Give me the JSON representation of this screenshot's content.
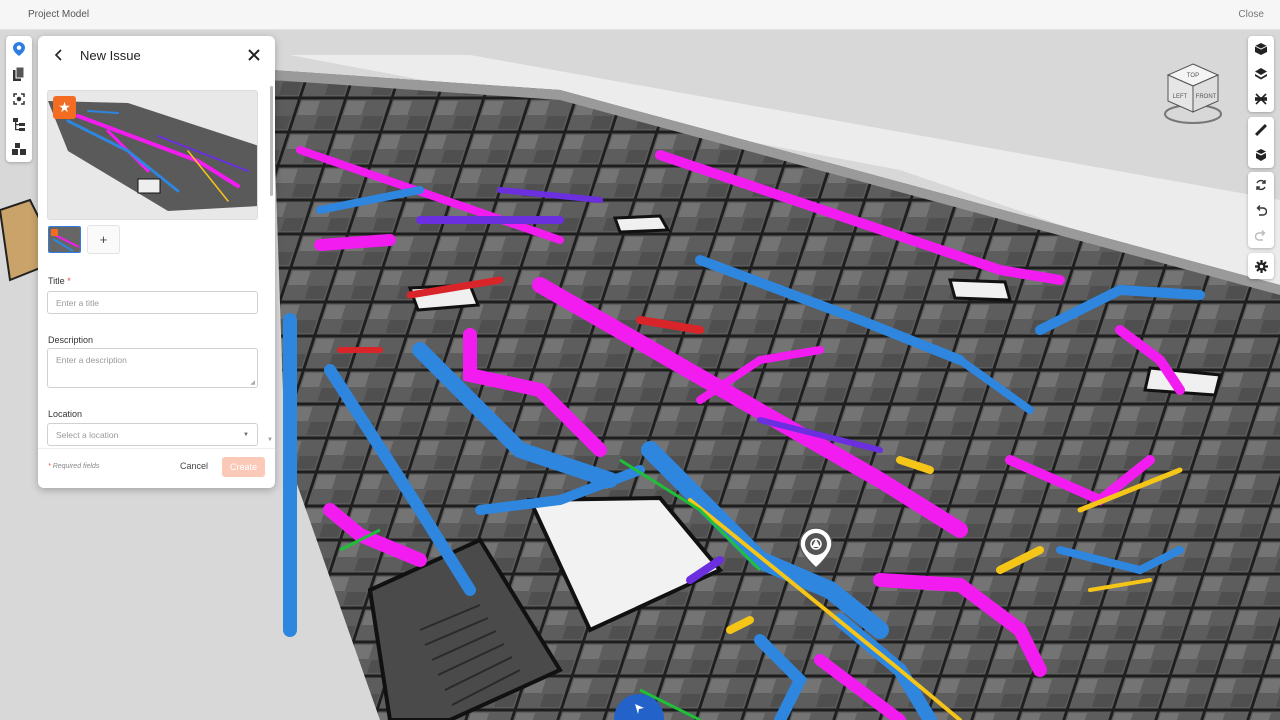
{
  "app": {
    "title": "Project Model",
    "close_label": "Close"
  },
  "panel": {
    "heading": "New Issue",
    "add_photo_label": "+",
    "title_field": {
      "label": "Title",
      "required_mark": "*",
      "placeholder": "Enter a title"
    },
    "description_field": {
      "label": "Description",
      "placeholder": "Enter a description"
    },
    "location_field": {
      "label": "Location",
      "placeholder": "Select a location"
    },
    "footer": {
      "required_mark": "*",
      "required_note": "Required fields",
      "cancel_label": "Cancel",
      "create_label": "Create"
    }
  },
  "left_toolbar": [
    "location-pin-icon",
    "documents-icon",
    "focus-frame-icon",
    "model-tree-icon",
    "objects-icon"
  ],
  "right_toolbar": {
    "group1": [
      "cube-icon",
      "layers-icon",
      "section-cut-icon"
    ],
    "group2": [
      "measure-ruler-icon",
      "explode-icon"
    ],
    "group3": [
      "refresh-icon",
      "undo-icon",
      "redo-icon"
    ],
    "group4": [
      "settings-gear-icon"
    ]
  },
  "viewcube": {
    "top": "TOP",
    "left": "LEFT",
    "front": "FRONT"
  },
  "colors": {
    "accent_orange": "#f26d21",
    "create_disabled": "#fbc9b8",
    "pipe_magenta": "#f21cf0",
    "pipe_blue": "#2e86de",
    "pipe_yellow": "#f5c518",
    "pipe_purple": "#6b2fe0",
    "pipe_green": "#1fbf3a",
    "pipe_red": "#d9252a",
    "floor_gray": "#6a6a6a",
    "nav_blue": "#2363c9"
  }
}
